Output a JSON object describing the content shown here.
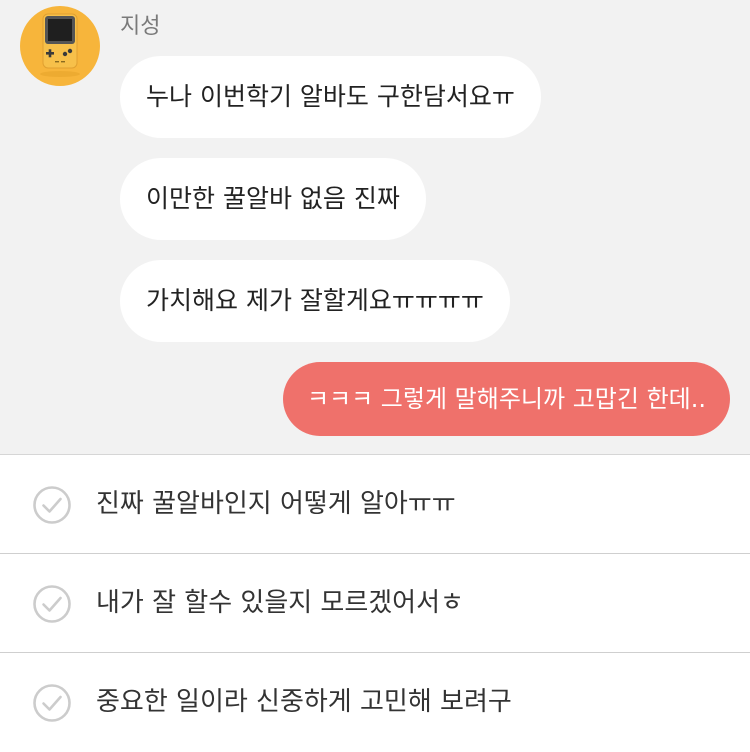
{
  "chat": {
    "sender_name": "지성",
    "avatar_icon": "game-console-icon",
    "incoming_messages": [
      "누나 이번학기 알바도 구한담서요ㅠ",
      "이만한 꿀알바 없음 진짜",
      "가치해요 제가 잘할게요ㅠㅠㅠㅠ"
    ],
    "outgoing_messages": [
      "ㅋㅋㅋ 그렇게 말해주니까 고맙긴 한데.."
    ]
  },
  "reply_options": [
    {
      "label": "진짜 꿀알바인지 어떻게 알아ㅠㅠ",
      "icon": "check-circle-icon"
    },
    {
      "label": "내가 잘 할수 있을지 모르겠어서ㅎ",
      "icon": "check-circle-icon"
    },
    {
      "label": "중요한 일이라 신중하게 고민해 보려구",
      "icon": "check-circle-icon"
    }
  ],
  "colors": {
    "chat_background": "#f2f2f2",
    "incoming_bubble": "#ffffff",
    "outgoing_bubble": "#ef716b",
    "avatar_background": "#f7b53b"
  }
}
